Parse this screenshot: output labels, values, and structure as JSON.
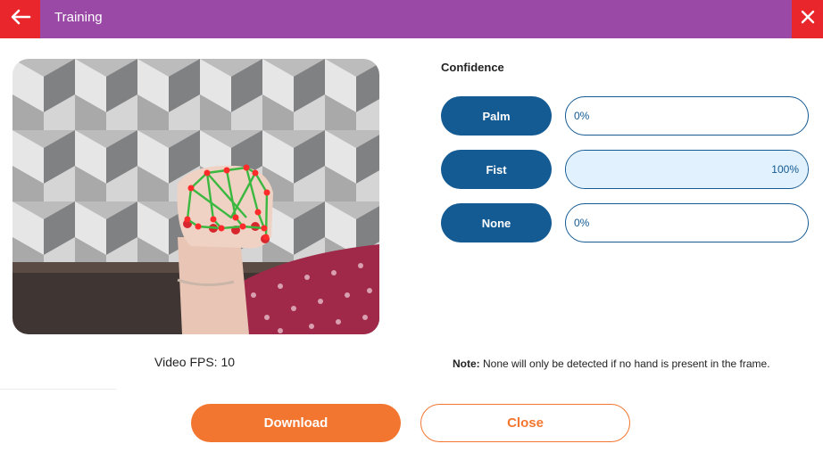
{
  "header": {
    "title": "Training",
    "back_icon": "arrow-left-icon",
    "close_icon": "close-icon",
    "bg_color": "#9a4aa6",
    "accent_color": "#e8262b"
  },
  "video": {
    "fps_label": "Video FPS: 10"
  },
  "confidence": {
    "title": "Confidence",
    "classes": [
      {
        "label": "Palm",
        "value_text": "0%",
        "value": 0
      },
      {
        "label": "Fist",
        "value_text": "100%",
        "value": 100
      },
      {
        "label": "None",
        "value_text": "0%",
        "value": 0
      }
    ],
    "pill_color": "#145a93"
  },
  "note": {
    "prefix": "Note:",
    "text": " None will only be detected if no hand is present in the frame."
  },
  "buttons": {
    "download_label": "Download",
    "close_label": "Close",
    "accent_color": "#f27630"
  }
}
